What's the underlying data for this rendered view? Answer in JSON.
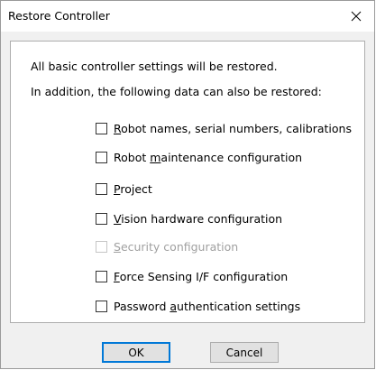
{
  "dialog": {
    "title": "Restore Controller"
  },
  "intro": {
    "line1": "All basic controller settings will be restored.",
    "line2": "In addition, the following data can also be restored:"
  },
  "options": [
    {
      "pre": "",
      "key": "R",
      "post": "obot names, serial numbers, calibrations",
      "checked": false,
      "enabled": true
    },
    {
      "pre": "Robot ",
      "key": "m",
      "post": "aintenance configuration",
      "checked": false,
      "enabled": true
    },
    {
      "pre": "",
      "key": "P",
      "post": "roject",
      "checked": false,
      "enabled": true
    },
    {
      "pre": "",
      "key": "V",
      "post": "ision hardware configuration",
      "checked": false,
      "enabled": true
    },
    {
      "pre": "",
      "key": "S",
      "post": "ecurity configuration",
      "checked": false,
      "enabled": false
    },
    {
      "pre": "",
      "key": "F",
      "post": "orce Sensing I/F configuration",
      "checked": false,
      "enabled": true
    },
    {
      "pre": "Password ",
      "key": "a",
      "post": "uthentication settings",
      "checked": false,
      "enabled": true
    }
  ],
  "buttons": {
    "ok_label": "OK",
    "cancel_label": "Cancel"
  },
  "colors": {
    "default_button_border": "#0078d7",
    "disabled_text": "#a0a0a0"
  },
  "icons": {
    "close": "close-icon"
  }
}
